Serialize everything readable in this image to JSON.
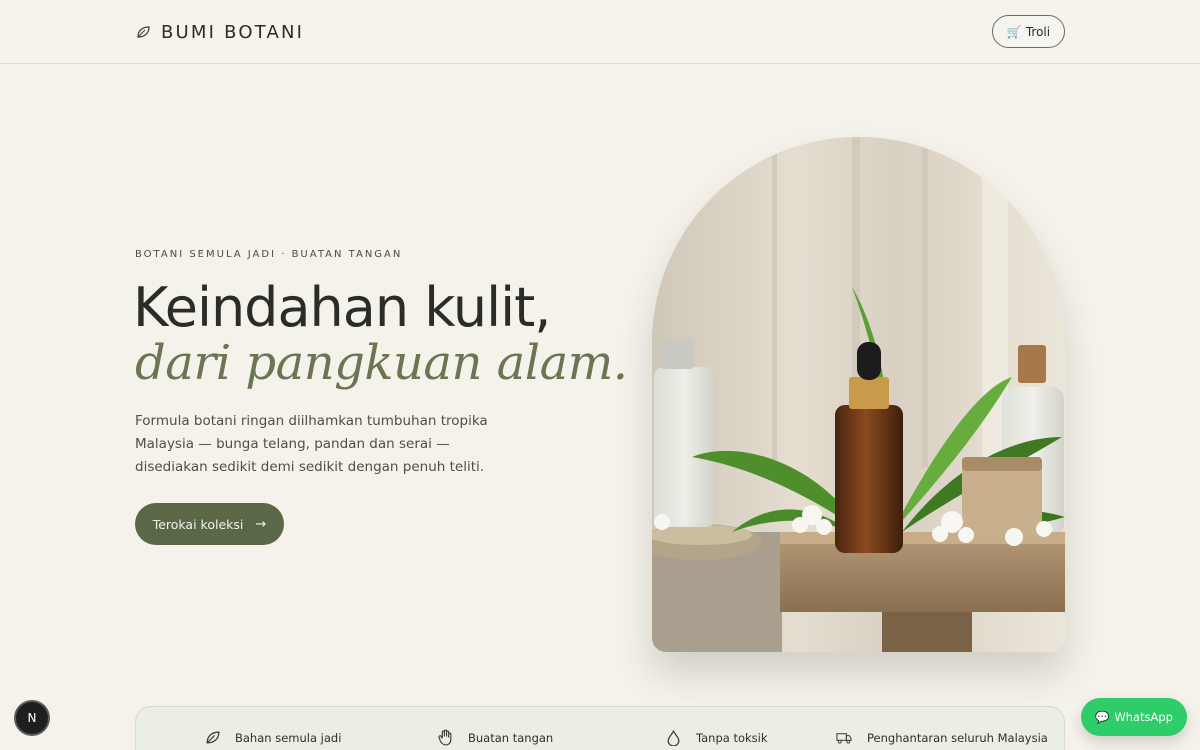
{
  "header": {
    "brand": "BUMI BOTANI",
    "brand_icon": "leaf-icon",
    "cart_label": "Troli",
    "cart_icon": "🛒"
  },
  "hero": {
    "eyebrow": "BOTANI SEMULA JADI · BUATAN TANGAN",
    "headline_line1": "Keindahan kulit,",
    "headline_line2": "dari pangkuan alam.",
    "lede_lines": [
      "Formula botani ringan diilhamkan tumbuhan tropika",
      "Malaysia — bunga telang, pandan dan serai —",
      "disediakan sedikit demi sedikit dengan penuh teliti."
    ],
    "cta_label": "Terokai koleksi",
    "cta_arrow": "→"
  },
  "features": [
    {
      "label": "Bahan semula jadi",
      "icon": "leaf-icon"
    },
    {
      "label": "Buatan tangan",
      "icon": "hand-icon"
    },
    {
      "label": "Tanpa toksik",
      "icon": "droplet-icon"
    },
    {
      "label": "Penghantaran seluruh Malaysia",
      "icon": "truck-icon"
    }
  ],
  "floating": {
    "n_badge": "N",
    "whatsapp_label": "WhatsApp",
    "whatsapp_icon": "💬"
  },
  "colors": {
    "background": "#f4f2ea",
    "accent": "#5b6848",
    "headline_italic": "#6b7552",
    "whatsapp": "#2fcc6a"
  }
}
